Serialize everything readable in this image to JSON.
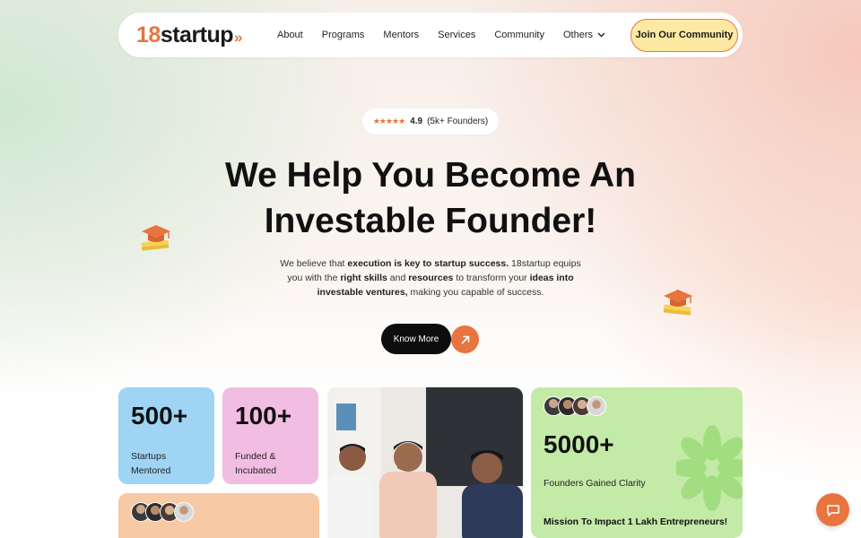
{
  "nav": {
    "logo_num": "18",
    "logo_word": "startup",
    "logo_chevron": "»",
    "items": [
      {
        "label": "About"
      },
      {
        "label": "Programs"
      },
      {
        "label": "Mentors"
      },
      {
        "label": "Services"
      },
      {
        "label": "Community"
      },
      {
        "label": "Others"
      }
    ],
    "cta_label": "Join Our Community"
  },
  "rating": {
    "stars": "★★★★★",
    "score": "4.9",
    "count": "(5k+ Founders)"
  },
  "hero": {
    "title_line1": "We Help You Become An",
    "title_line2": "Investable Founder!",
    "desc_1": "We believe that ",
    "desc_2": "execution is key to startup success.",
    "desc_3": " 18startup equips you with the ",
    "desc_4": "right skills",
    "desc_5": " and ",
    "desc_6": "resources",
    "desc_7": " to transform your ",
    "desc_8": "ideas into investable ventures,",
    "desc_9": " making you capable of success.",
    "cta_label": "Know More"
  },
  "stats": {
    "startups_value": "500+",
    "startups_label": "Startups Mentored",
    "funded_value": "100+",
    "funded_label": "Funded & Incubated",
    "founders_value": "5000+",
    "founders_label": "Founders Gained Clarity",
    "mission": "Mission To Impact 1 Lakh Entrepreneurs!"
  },
  "colors": {
    "accent": "#e8743f",
    "cta_bg": "#fde9a2",
    "card_blue": "#9fd4f5",
    "card_pink": "#f2bde2",
    "card_peach": "#f7c9a5",
    "card_green": "#c4eaa8"
  },
  "icons": {
    "dropdown": "chevron-down-icon",
    "arrow": "arrow-up-right-icon",
    "chat": "chat-icon",
    "cap": "graduation-cap-icon"
  }
}
